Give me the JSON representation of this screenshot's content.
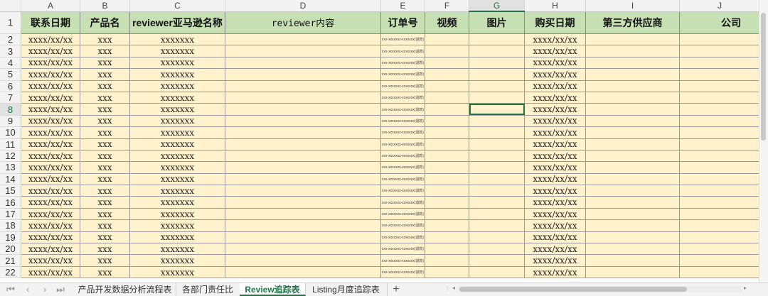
{
  "columns": [
    "A",
    "B",
    "C",
    "D",
    "E",
    "F",
    "G",
    "H",
    "I",
    "J"
  ],
  "selected_column": "G",
  "selected_row": "8",
  "header_row_number": "1",
  "headers": [
    "联系日期",
    "产品名",
    "reviewer亚马逊名称",
    "reviewer内容",
    "订单号",
    "视频",
    "图片",
    "购买日期",
    "第三方供应商",
    "公司"
  ],
  "rows": [
    {
      "num": "2",
      "cells": [
        "xxxx/xx/xx",
        "xxx",
        "xxxxxxx",
        "",
        "xxx-xxxxxxx-xxxxxxx(退款)",
        "",
        "",
        "xxxx/xx/xx",
        "",
        ""
      ]
    },
    {
      "num": "3",
      "cells": [
        "xxxx/xx/xx",
        "xxx",
        "xxxxxxx",
        "",
        "xxx-xxxxxxx-xxxxxxx(退款)",
        "",
        "",
        "xxxx/xx/xx",
        "",
        ""
      ]
    },
    {
      "num": "4",
      "cells": [
        "xxxx/xx/xx",
        "xxx",
        "xxxxxxx",
        "",
        "xxx-xxxxxxx-xxxxxxx(退款)",
        "",
        "",
        "xxxx/xx/xx",
        "",
        ""
      ]
    },
    {
      "num": "5",
      "cells": [
        "xxxx/xx/xx",
        "xxx",
        "xxxxxxx",
        "",
        "xxx-xxxxxxx-xxxxxxx(退款)",
        "",
        "",
        "xxxx/xx/xx",
        "",
        ""
      ]
    },
    {
      "num": "6",
      "cells": [
        "xxxx/xx/xx",
        "xxx",
        "xxxxxxx",
        "",
        "xxx-xxxxxxx-xxxxxxx(退款)",
        "",
        "",
        "xxxx/xx/xx",
        "",
        ""
      ]
    },
    {
      "num": "7",
      "cells": [
        "xxxx/xx/xx",
        "xxx",
        "xxxxxxx",
        "",
        "xxx-xxxxxxx-xxxxxxx(退款)",
        "",
        "",
        "xxxx/xx/xx",
        "",
        ""
      ]
    },
    {
      "num": "8",
      "cells": [
        "xxxx/xx/xx",
        "xxx",
        "xxxxxxx",
        "",
        "xxx-xxxxxxx-xxxxxxx(退款)",
        "",
        "",
        "xxxx/xx/xx",
        "",
        ""
      ]
    },
    {
      "num": "9",
      "cells": [
        "xxxx/xx/xx",
        "xxx",
        "xxxxxxx",
        "",
        "xxx-xxxxxxx-xxxxxxx(退款)",
        "",
        "",
        "xxxx/xx/xx",
        "",
        ""
      ]
    },
    {
      "num": "10",
      "cells": [
        "xxxx/xx/xx",
        "xxx",
        "xxxxxxx",
        "",
        "xxx-xxxxxxx-xxxxxxx(退款)",
        "",
        "",
        "xxxx/xx/xx",
        "",
        ""
      ]
    },
    {
      "num": "11",
      "cells": [
        "xxxx/xx/xx",
        "xxx",
        "xxxxxxx",
        "",
        "xxx-xxxxxxx-xxxxxxx(退款)",
        "",
        "",
        "xxxx/xx/xx",
        "",
        ""
      ]
    },
    {
      "num": "12",
      "cells": [
        "xxxx/xx/xx",
        "xxx",
        "xxxxxxx",
        "",
        "xxx-xxxxxxx-xxxxxxx(退款)",
        "",
        "",
        "xxxx/xx/xx",
        "",
        ""
      ]
    },
    {
      "num": "13",
      "cells": [
        "xxxx/xx/xx",
        "xxx",
        "xxxxxxx",
        "",
        "xxx-xxxxxxx-xxxxxxx(退款)",
        "",
        "",
        "xxxx/xx/xx",
        "",
        ""
      ]
    },
    {
      "num": "14",
      "cells": [
        "xxxx/xx/xx",
        "xxx",
        "xxxxxxx",
        "",
        "xxx-xxxxxxx-xxxxxxx(退款)",
        "",
        "",
        "xxxx/xx/xx",
        "",
        ""
      ]
    },
    {
      "num": "15",
      "cells": [
        "xxxx/xx/xx",
        "xxx",
        "xxxxxxx",
        "",
        "xxx-xxxxxxx-xxxxxxx(退款)",
        "",
        "",
        "xxxx/xx/xx",
        "",
        ""
      ]
    },
    {
      "num": "16",
      "cells": [
        "xxxx/xx/xx",
        "xxx",
        "xxxxxxx",
        "",
        "xxx-xxxxxxx-xxxxxxx(退款)",
        "",
        "",
        "xxxx/xx/xx",
        "",
        ""
      ]
    },
    {
      "num": "17",
      "cells": [
        "xxxx/xx/xx",
        "xxx",
        "xxxxxxx",
        "",
        "xxx-xxxxxxx-xxxxxxx(退款)",
        "",
        "",
        "xxxx/xx/xx",
        "",
        ""
      ]
    },
    {
      "num": "18",
      "cells": [
        "xxxx/xx/xx",
        "xxx",
        "xxxxxxx",
        "",
        "xxx-xxxxxxx-xxxxxxx(退款)",
        "",
        "",
        "xxxx/xx/xx",
        "",
        ""
      ]
    },
    {
      "num": "19",
      "cells": [
        "xxxx/xx/xx",
        "xxx",
        "xxxxxxx",
        "",
        "xxx-xxxxxxx-xxxxxxx(退款)",
        "",
        "",
        "xxxx/xx/xx",
        "",
        ""
      ]
    },
    {
      "num": "20",
      "cells": [
        "xxxx/xx/xx",
        "xxx",
        "xxxxxxx",
        "",
        "xxx-xxxxxxx-xxxxxxx(退款)",
        "",
        "",
        "xxxx/xx/xx",
        "",
        ""
      ]
    },
    {
      "num": "21",
      "cells": [
        "xxxx/xx/xx",
        "xxx",
        "xxxxxxx",
        "",
        "xxx-xxxxxxx-xxxxxxx(退款)",
        "",
        "",
        "xxxx/xx/xx",
        "",
        ""
      ]
    },
    {
      "num": "22",
      "cells": [
        "xxxx/xx/xx",
        "xxx",
        "xxxxxxx",
        "",
        "xxx-xxxxxxx-xxxxxxx(退款)",
        "",
        "",
        "xxxx/xx/xx",
        "",
        ""
      ]
    }
  ],
  "sheet_tabs": [
    {
      "label": "产品开发数据分析流程表",
      "active": false
    },
    {
      "label": "各部门责任比",
      "active": false
    },
    {
      "label": "Review追踪表",
      "active": true
    },
    {
      "label": "Listing月度追踪表",
      "active": false
    }
  ],
  "tab_nav_icons": [
    "first-sheet-icon",
    "prev-sheet-icon",
    "next-sheet-icon",
    "last-sheet-icon"
  ],
  "add_tab_glyph": "+",
  "colors": {
    "header_fill": "#c6e0b4",
    "data_fill": "#fff2cc",
    "accent": "#217346"
  }
}
